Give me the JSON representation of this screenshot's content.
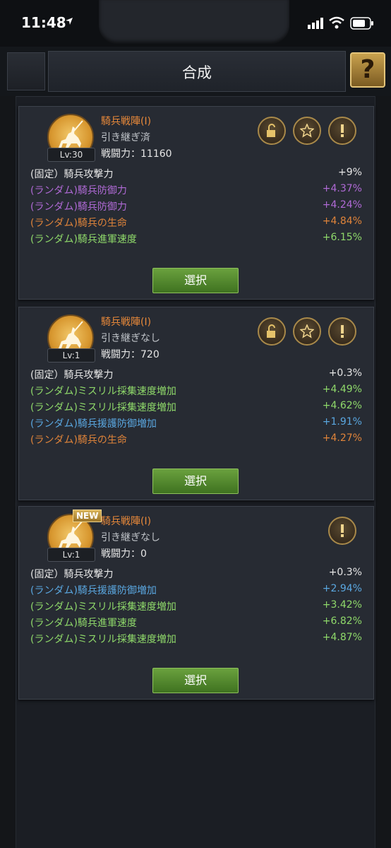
{
  "status": {
    "time": "11:48"
  },
  "header": {
    "title": "合成",
    "help_label": "?"
  },
  "cards": [
    {
      "name": "騎兵戦陣(I)",
      "level": "Lv:30",
      "inherit": "引き継ぎ済",
      "power_label": "戦闘力：",
      "power_value": "11160",
      "stats": [
        {
          "label": "(固定）騎兵攻撃力",
          "value": "+9%",
          "color": "#e6e6e6"
        },
        {
          "label": "(ランダム)騎兵防御力",
          "value": "+4.37%",
          "color": "#b06ad6"
        },
        {
          "label": "(ランダム)騎兵防御力",
          "value": "+4.24%",
          "color": "#b06ad6"
        },
        {
          "label": "(ランダム)騎兵の生命",
          "value": "+4.84%",
          "color": "#e0843a"
        },
        {
          "label": "(ランダム)騎兵進軍速度",
          "value": "+6.15%",
          "color": "#8fd96a"
        }
      ],
      "select_label": "選択"
    },
    {
      "name": "騎兵戦陣(I)",
      "level": "Lv:1",
      "inherit": "引き継ぎなし",
      "power_label": "戦闘力：",
      "power_value": "720",
      "stats": [
        {
          "label": "(固定）騎兵攻撃力",
          "value": "+0.3%",
          "color": "#e6e6e6"
        },
        {
          "label": "(ランダム)ミスリル採集速度増加",
          "value": "+4.49%",
          "color": "#8fd96a"
        },
        {
          "label": "(ランダム)ミスリル採集速度増加",
          "value": "+4.62%",
          "color": "#8fd96a"
        },
        {
          "label": "(ランダム)騎兵援護防御増加",
          "value": "+1.91%",
          "color": "#5aa7e0"
        },
        {
          "label": "(ランダム)騎兵の生命",
          "value": "+4.27%",
          "color": "#e0843a"
        }
      ],
      "select_label": "選択"
    },
    {
      "name": "騎兵戦陣(I)",
      "level": "Lv:1",
      "new_badge": "NEW",
      "inherit": "引き継ぎなし",
      "power_label": "戦闘力：",
      "power_value": "0",
      "stats": [
        {
          "label": "(固定）騎兵攻撃力",
          "value": "+0.3%",
          "color": "#e6e6e6"
        },
        {
          "label": "(ランダム)騎兵援護防御増加",
          "value": "+2.94%",
          "color": "#5aa7e0"
        },
        {
          "label": "(ランダム)ミスリル採集速度増加",
          "value": "+3.42%",
          "color": "#8fd96a"
        },
        {
          "label": "(ランダム)騎兵進軍速度",
          "value": "+6.82%",
          "color": "#8fd96a"
        },
        {
          "label": "(ランダム)ミスリル採集速度増加",
          "value": "+4.87%",
          "color": "#8fd96a"
        }
      ],
      "select_label": "選択"
    }
  ],
  "colors": {
    "background": "#1b1e24",
    "card": "#272b33",
    "name_orange": "#e8893a",
    "select_green": "#4f8a2c"
  },
  "icons": [
    "location-arrow-icon",
    "signal-icon",
    "wifi-icon",
    "battery-icon",
    "help-icon",
    "knight-icon",
    "unlock-icon",
    "star-icon",
    "info-icon"
  ]
}
